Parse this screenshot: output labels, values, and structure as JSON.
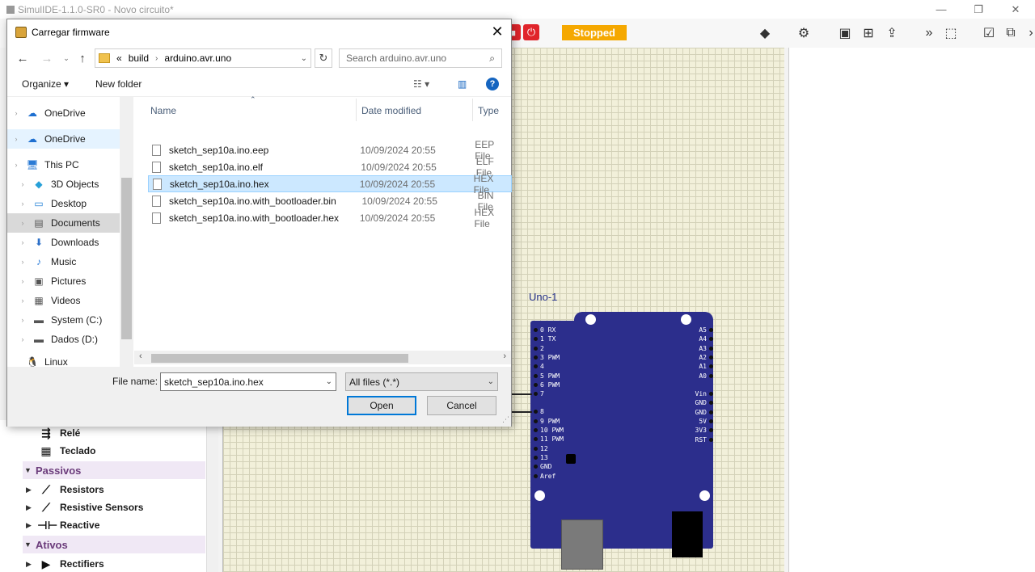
{
  "window": {
    "title": "SimulIDE-1.1.0-SR0 - Novo circuito*",
    "minimize": "—",
    "restore": "❐",
    "close": "✕"
  },
  "toolbar": {
    "status": "Stopped",
    "status_color": "#f5a800"
  },
  "left_panel": {
    "items": [
      {
        "label": "Relé",
        "icon": "relay-icon",
        "type": "item"
      },
      {
        "label": "Teclado",
        "icon": "keypad-icon",
        "type": "item"
      },
      {
        "label": "Passivos",
        "type": "category"
      },
      {
        "label": "Resistors",
        "icon": "resistor-icon",
        "type": "item"
      },
      {
        "label": "Resistive Sensors",
        "icon": "resistive-sensor-icon",
        "type": "item"
      },
      {
        "label": "Reactive",
        "icon": "reactive-icon",
        "type": "item"
      },
      {
        "label": "Ativos",
        "type": "category"
      },
      {
        "label": "Rectifiers",
        "icon": "diode-icon",
        "type": "item"
      }
    ]
  },
  "board": {
    "label": "Uno-1",
    "left_pins": [
      "0 RX",
      "1 TX",
      "2",
      "3 PWM",
      "4",
      "5 PWM",
      "6 PWM",
      "7",
      "8",
      "9 PWM",
      "10 PWM",
      "11 PWM",
      "12",
      "13",
      "GND",
      "Aref"
    ],
    "right_pins_top": [
      "A5",
      "A4",
      "A3",
      "A2",
      "A1",
      "A0"
    ],
    "right_pins_bottom": [
      "Vin",
      "GND",
      "GND",
      "5V",
      "3V3",
      "RST"
    ]
  },
  "dialog": {
    "title": "Carregar firmware",
    "breadcrumb": {
      "prefix": "«",
      "parts": [
        "build",
        "arduino.avr.uno"
      ]
    },
    "search_placeholder": "Search arduino.avr.uno",
    "organize": "Organize ▾",
    "new_folder": "New folder",
    "nav": [
      {
        "label": "OneDrive",
        "icon": "cloud-icon"
      },
      {
        "label": "OneDrive",
        "icon": "cloud-icon"
      },
      {
        "label": "This PC",
        "icon": "computer-icon"
      },
      {
        "label": "3D Objects",
        "icon": "cube-icon"
      },
      {
        "label": "Desktop",
        "icon": "desktop-icon"
      },
      {
        "label": "Documents",
        "icon": "documents-icon"
      },
      {
        "label": "Downloads",
        "icon": "download-icon"
      },
      {
        "label": "Music",
        "icon": "music-icon"
      },
      {
        "label": "Pictures",
        "icon": "pictures-icon"
      },
      {
        "label": "Videos",
        "icon": "videos-icon"
      },
      {
        "label": "System (C:)",
        "icon": "drive-icon"
      },
      {
        "label": "Dados (D:)",
        "icon": "drive-icon"
      },
      {
        "label": "Linux",
        "icon": "linux-icon"
      }
    ],
    "columns": {
      "name": "Name",
      "date": "Date modified",
      "type": "Type"
    },
    "files": [
      {
        "name": "sketch_sep10a.ino.eep",
        "date": "10/09/2024 20:55",
        "type": "EEP File"
      },
      {
        "name": "sketch_sep10a.ino.elf",
        "date": "10/09/2024 20:55",
        "type": "ELF File"
      },
      {
        "name": "sketch_sep10a.ino.hex",
        "date": "10/09/2024 20:55",
        "type": "HEX File"
      },
      {
        "name": "sketch_sep10a.ino.with_bootloader.bin",
        "date": "10/09/2024 20:55",
        "type": "BIN File"
      },
      {
        "name": "sketch_sep10a.ino.with_bootloader.hex",
        "date": "10/09/2024 20:55",
        "type": "HEX File"
      }
    ],
    "file_name_label": "File name:",
    "file_name_value": "sketch_sep10a.ino.hex",
    "filter_value": "All files (*.*)",
    "open_label": "Open",
    "cancel_label": "Cancel"
  }
}
